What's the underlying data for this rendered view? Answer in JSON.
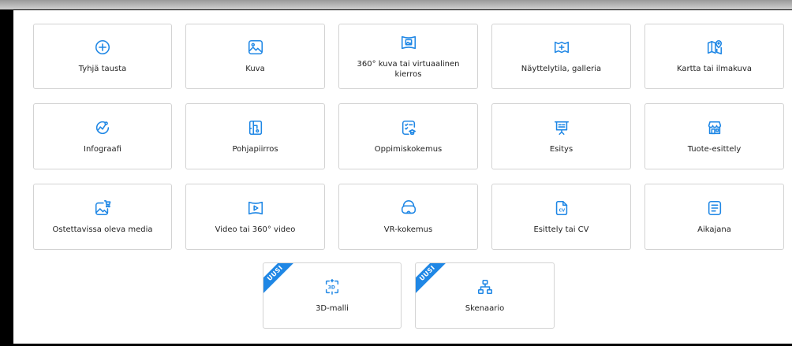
{
  "accent_color": "#1f87e5",
  "items": [
    {
      "label": "Tyhjä tausta",
      "icon": "plus-circle-icon"
    },
    {
      "label": "Kuva",
      "icon": "image-icon"
    },
    {
      "label": "360° kuva tai virtuaalinen kierros",
      "icon": "panorama-icon"
    },
    {
      "label": "Näyttelytila, galleria",
      "icon": "exhibition-map-icon"
    },
    {
      "label": "Kartta tai ilmakuva",
      "icon": "map-pin-icon"
    },
    {
      "label": "Infograafi",
      "icon": "infographic-icon"
    },
    {
      "label": "Pohjapiirros",
      "icon": "floorplan-icon"
    },
    {
      "label": "Oppimiskokemus",
      "icon": "learning-icon"
    },
    {
      "label": "Esitys",
      "icon": "presentation-icon"
    },
    {
      "label": "Tuote-esittely",
      "icon": "store-icon"
    },
    {
      "label": "Ostettavissa oleva media",
      "icon": "shop-media-icon"
    },
    {
      "label": "Video tai 360° video",
      "icon": "video-icon"
    },
    {
      "label": "VR-kokemus",
      "icon": "vr-headset-icon"
    },
    {
      "label": "Esittely tai CV",
      "icon": "cv-document-icon"
    },
    {
      "label": "Aikajana",
      "icon": "timeline-icon"
    },
    {
      "label": "3D-malli",
      "icon": "3d-model-icon",
      "badge": "UUSI"
    },
    {
      "label": "Skenaario",
      "icon": "scenario-icon",
      "badge": "UUSI"
    }
  ]
}
